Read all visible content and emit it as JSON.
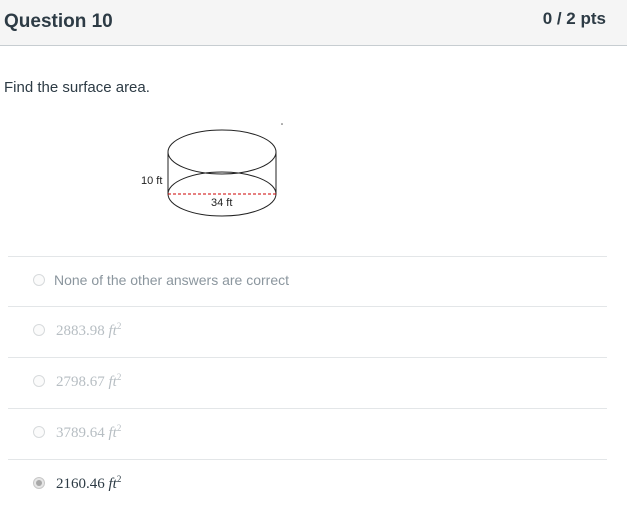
{
  "header": {
    "title": "Question 10",
    "points": "0 / 2 pts"
  },
  "question": {
    "prompt": "Find the surface area.",
    "figure": {
      "height_label": "10 ft",
      "diameter_label": "34 ft"
    }
  },
  "answers": [
    {
      "text": "None of the other answers are correct",
      "selected": false
    },
    {
      "value": "2883.98",
      "unit": "ft",
      "exp": "2",
      "selected": false
    },
    {
      "value": "2798.67",
      "unit": "ft",
      "exp": "2",
      "selected": false
    },
    {
      "value": "3789.64",
      "unit": "ft",
      "exp": "2",
      "selected": false
    },
    {
      "value": "2160.46",
      "unit": "ft",
      "exp": "2",
      "selected": true
    }
  ],
  "colors": {
    "header_bg": "#f5f5f5",
    "text": "#2d3b45",
    "muted_text": "#8b969e",
    "diameter_line": "#cc0000"
  }
}
